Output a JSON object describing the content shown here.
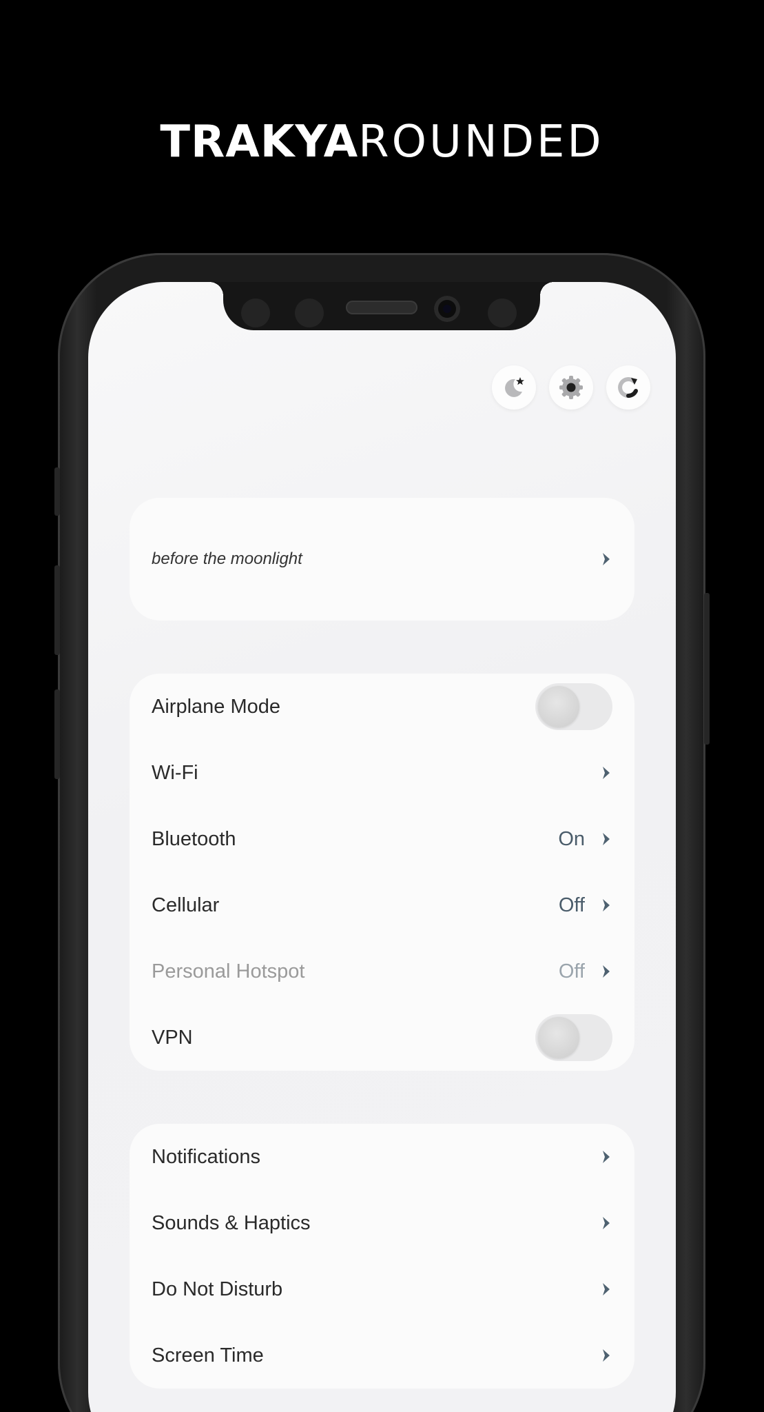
{
  "headline": {
    "bold": "TRAKYA",
    "light": "ROUNDED"
  },
  "top_icons": [
    {
      "name": "moon-star-icon"
    },
    {
      "name": "gear-icon"
    },
    {
      "name": "refresh-icon"
    }
  ],
  "featured": {
    "label": "before the moonlight"
  },
  "connectivity": {
    "airplane": {
      "label": "Airplane Mode",
      "toggle": false
    },
    "wifi": {
      "label": "Wi-Fi"
    },
    "bluetooth": {
      "label": "Bluetooth",
      "value": "On"
    },
    "cellular": {
      "label": "Cellular",
      "value": "Off"
    },
    "hotspot": {
      "label": "Personal Hotspot",
      "value": "Off"
    },
    "vpn": {
      "label": "VPN",
      "toggle": false
    }
  },
  "general": {
    "notifications": {
      "label": "Notifications"
    },
    "sounds": {
      "label": "Sounds & Haptics"
    },
    "dnd": {
      "label": "Do Not Disturb"
    },
    "screen_time": {
      "label": "Screen Time"
    }
  },
  "colors": {
    "accent": "#4a5c6a",
    "chevron": "#4e6170",
    "background": "#000000",
    "screen": "#f2f2f4"
  }
}
